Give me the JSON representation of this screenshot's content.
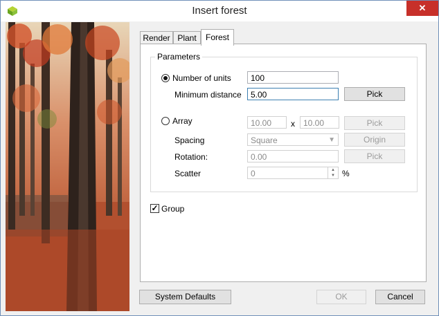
{
  "window": {
    "title": "Insert forest",
    "close_glyph": "✕"
  },
  "tabs": [
    {
      "label": "Render",
      "active": false
    },
    {
      "label": "Plant",
      "active": false
    },
    {
      "label": "Forest",
      "active": true
    }
  ],
  "parameters": {
    "group_label": "Parameters",
    "number_of_units": {
      "label": "Number of units",
      "value": "100",
      "selected": true
    },
    "minimum_distance": {
      "label": "Minimum distance",
      "value": "5.00",
      "pick_label": "Pick"
    },
    "array": {
      "label": "Array",
      "selected": false,
      "x_value": "10.00",
      "x_sep": "x",
      "y_value": "10.00",
      "pick_label": "Pick",
      "spacing": {
        "label": "Spacing",
        "value": "Square",
        "origin_label": "Origin"
      },
      "rotation": {
        "label": "Rotation:",
        "value": "0.00",
        "pick_label": "Pick"
      },
      "scatter": {
        "label": "Scatter",
        "value": "0",
        "unit": "%"
      }
    }
  },
  "group_checkbox": {
    "label": "Group",
    "checked": true,
    "glyph": "✓"
  },
  "footer": {
    "system_defaults_label": "System Defaults",
    "ok_label": "OK",
    "cancel_label": "Cancel"
  },
  "colors": {
    "accent": "#c7302a",
    "disabled_text": "#9b9b9b"
  }
}
